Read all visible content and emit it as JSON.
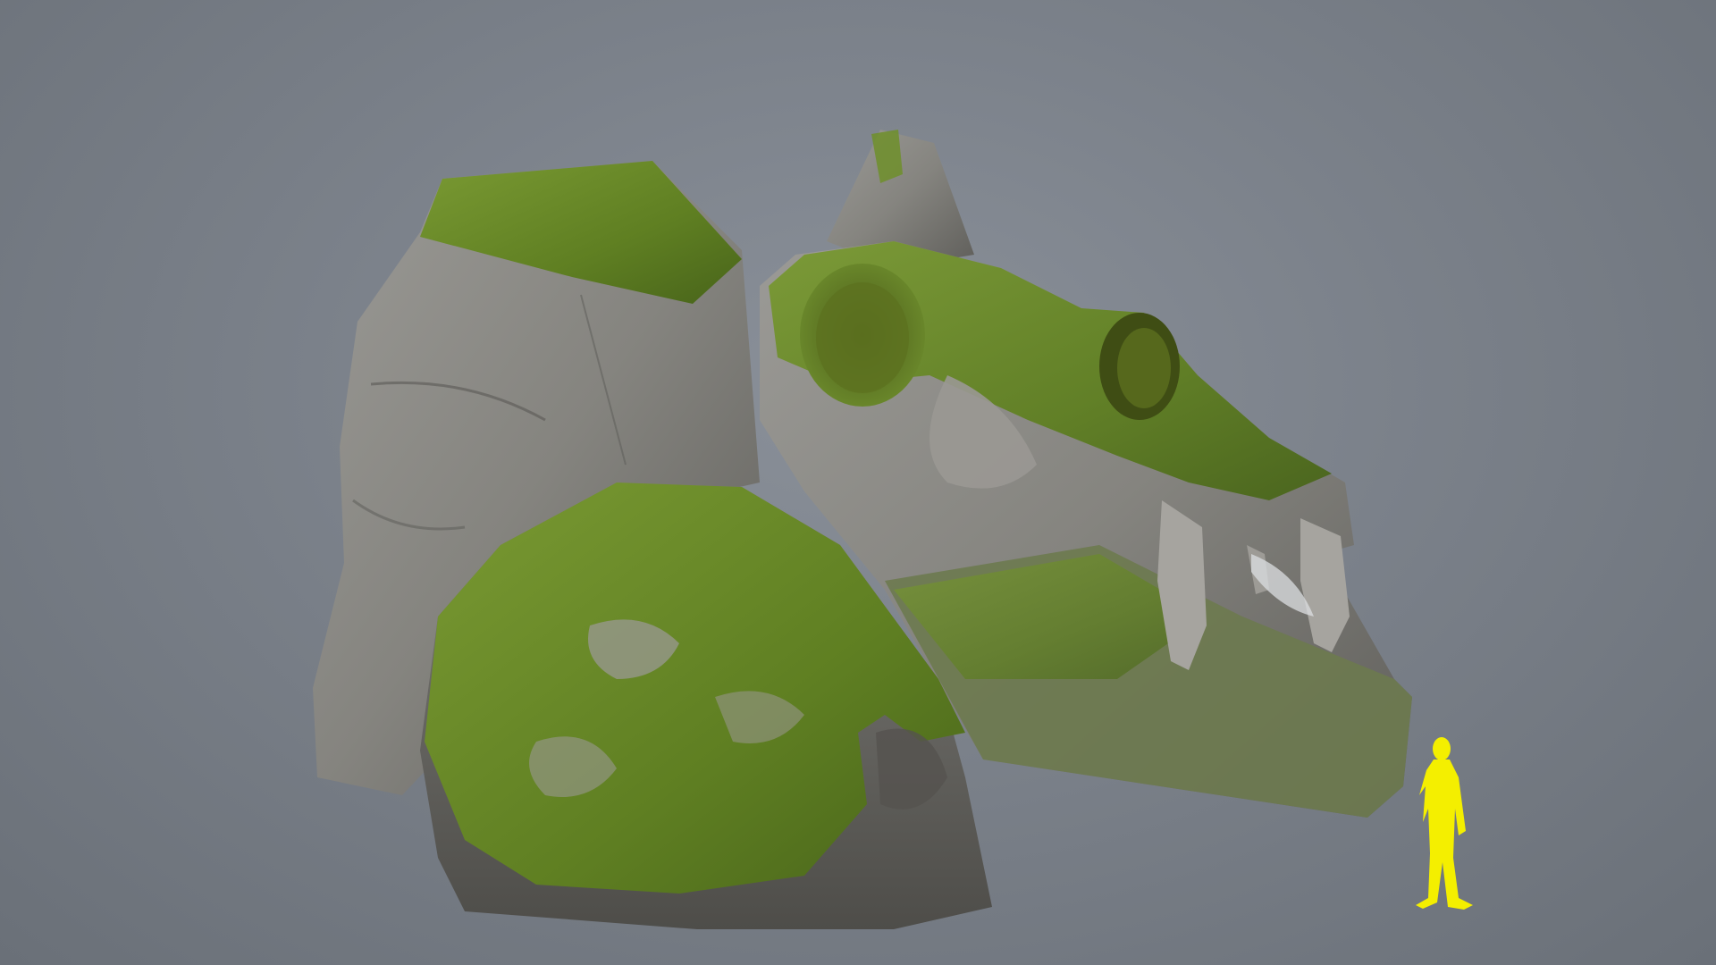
{
  "scene": {
    "subject": "moss-covered-rock-skull-sculpture",
    "background_color": "#7b818a",
    "rock_color": "#8c8c88",
    "moss_color": "#6f8f2e",
    "scale_figure_color": "#f4ef00"
  }
}
